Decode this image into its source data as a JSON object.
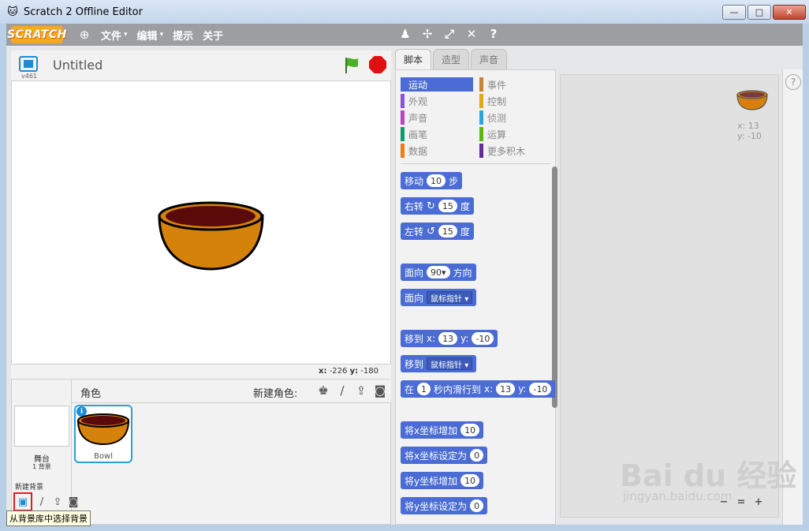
{
  "window": {
    "title": "Scratch 2 Offline Editor",
    "minimize": "—",
    "maximize": "□",
    "close": "✕"
  },
  "menubar": {
    "logo": "SCRATCH",
    "items": [
      {
        "label": "文件",
        "caret": "▾"
      },
      {
        "label": "编辑",
        "caret": "▾"
      },
      {
        "label": "提示",
        "caret": ""
      },
      {
        "label": "关于",
        "caret": ""
      }
    ],
    "help_glyph": "?"
  },
  "stage": {
    "version": "v461",
    "project_title": "Untitled",
    "coords": {
      "x_label": "x:",
      "x_value": "-226",
      "y_label": "y:",
      "y_value": "-180"
    }
  },
  "sprites": {
    "header_label": "角色",
    "new_sprite_label": "新建角色:",
    "stage_name": "舞台",
    "stage_bg_count": "1 背景",
    "new_backdrop_label": "新建背景",
    "tooltip": "从背景库中选择背景",
    "list": [
      {
        "name": "Bowl",
        "info": "i"
      }
    ]
  },
  "tabs": [
    {
      "label": "脚本"
    },
    {
      "label": "造型"
    },
    {
      "label": "声音"
    }
  ],
  "categories": [
    {
      "label": "运动",
      "color": "#4a6cd4"
    },
    {
      "label": "事件",
      "color": "#c88330"
    },
    {
      "label": "外观",
      "color": "#8a55d7"
    },
    {
      "label": "控制",
      "color": "#e1a91a"
    },
    {
      "label": "声音",
      "color": "#bb42c3"
    },
    {
      "label": "侦测",
      "color": "#2ca5e2"
    },
    {
      "label": "画笔",
      "color": "#0e9a6c"
    },
    {
      "label": "运算",
      "color": "#5cb712"
    },
    {
      "label": "数据",
      "color": "#ee7d16"
    },
    {
      "label": "更多积木",
      "color": "#632d99"
    }
  ],
  "blocks": {
    "move": {
      "pre": "移动",
      "val": "10",
      "post": "步"
    },
    "turn_right": {
      "pre": "右转",
      "icon": "↻",
      "val": "15",
      "post": "度"
    },
    "turn_left": {
      "pre": "左转",
      "icon": "↺",
      "val": "15",
      "post": "度"
    },
    "point_dir": {
      "pre": "面向",
      "val": "90▾",
      "post": "方向"
    },
    "point_towards": {
      "pre": "面向",
      "dd": "鼠标指针 ▾"
    },
    "goto_xy": {
      "pre": "移到",
      "xl": "x:",
      "xv": "13",
      "yl": "y:",
      "yv": "-10"
    },
    "goto": {
      "pre": "移到",
      "dd": "鼠标指针 ▾"
    },
    "glide": {
      "pre": "在",
      "val": "1",
      "mid": "秒内滑行到",
      "xl": "x:",
      "xv": "13",
      "yl": "y:",
      "yv": "-10"
    },
    "change_x": {
      "pre": "将x坐标增加",
      "val": "10"
    },
    "set_x": {
      "pre": "将x坐标设定为",
      "val": "0"
    },
    "change_y": {
      "pre": "将y坐标增加",
      "val": "10"
    },
    "set_y": {
      "pre": "将y坐标设定为",
      "val": "0"
    }
  },
  "scripts_area": {
    "sprite_x": "x: 13",
    "sprite_y": "y: -10",
    "zoom_out": "−",
    "zoom_reset": "=",
    "zoom_in": "+"
  },
  "watermark": {
    "logo": "Bai du 经验",
    "url": "jingyan.baidu.com"
  },
  "colors": {
    "accent": "#1e8bd9",
    "motion": "#4a6cd4",
    "bowl_fill": "#d5820a",
    "bowl_inner": "#5b0a0a"
  }
}
